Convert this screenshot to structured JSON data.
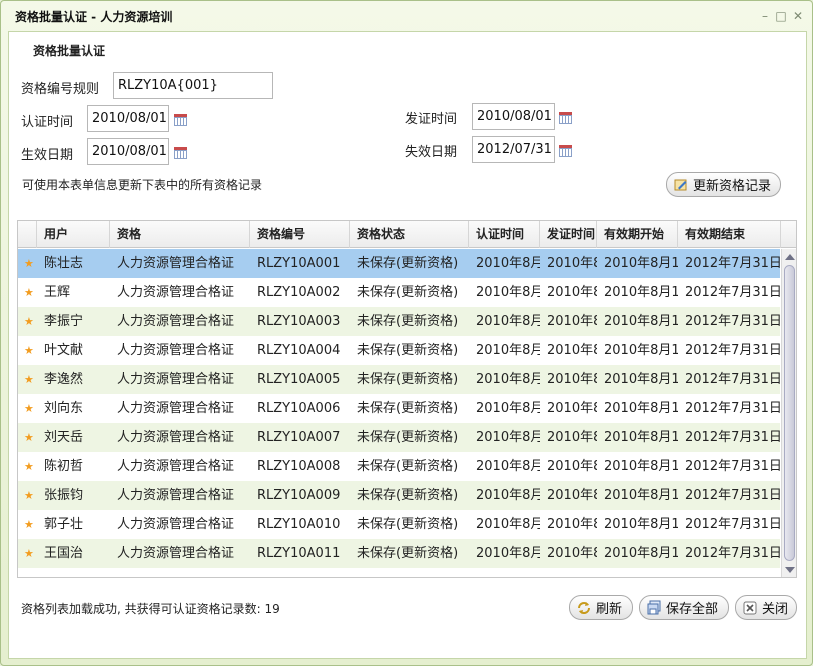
{
  "window": {
    "title": "资格批量认证 - 人力资源培训"
  },
  "form": {
    "section_title": "资格批量认证",
    "rule_label": "资格编号规则",
    "rule_value": "RLZY10A{001}",
    "cert_time_label": "认证时间",
    "cert_time_value": "2010/08/01",
    "issue_time_label": "发证时间",
    "issue_time_value": "2010/08/01",
    "effective_label": "生效日期",
    "effective_value": "2010/08/01",
    "expire_label": "失效日期",
    "expire_value": "2012/07/31",
    "hint": "可使用本表单信息更新下表中的所有资格记录",
    "update_button": "更新资格记录"
  },
  "grid": {
    "columns": [
      "用户",
      "资格",
      "资格编号",
      "资格状态",
      "认证时间",
      "发证时间",
      "有效期开始",
      "有效期结束"
    ],
    "rows": [
      {
        "user": "陈壮志",
        "qual": "人力资源管理合格证",
        "code": "RLZY10A001",
        "state": "未保存(更新资格)",
        "cert": "2010年8月",
        "issue": "2010年8",
        "start": "2010年8月1",
        "end": "2012年7月31日"
      },
      {
        "user": "王辉",
        "qual": "人力资源管理合格证",
        "code": "RLZY10A002",
        "state": "未保存(更新资格)",
        "cert": "2010年8月",
        "issue": "2010年8",
        "start": "2010年8月1",
        "end": "2012年7月31日"
      },
      {
        "user": "李振宁",
        "qual": "人力资源管理合格证",
        "code": "RLZY10A003",
        "state": "未保存(更新资格)",
        "cert": "2010年8月",
        "issue": "2010年8",
        "start": "2010年8月1",
        "end": "2012年7月31日"
      },
      {
        "user": "叶文献",
        "qual": "人力资源管理合格证",
        "code": "RLZY10A004",
        "state": "未保存(更新资格)",
        "cert": "2010年8月",
        "issue": "2010年8",
        "start": "2010年8月1",
        "end": "2012年7月31日"
      },
      {
        "user": "李逸然",
        "qual": "人力资源管理合格证",
        "code": "RLZY10A005",
        "state": "未保存(更新资格)",
        "cert": "2010年8月",
        "issue": "2010年8",
        "start": "2010年8月1",
        "end": "2012年7月31日"
      },
      {
        "user": "刘向东",
        "qual": "人力资源管理合格证",
        "code": "RLZY10A006",
        "state": "未保存(更新资格)",
        "cert": "2010年8月",
        "issue": "2010年8",
        "start": "2010年8月1",
        "end": "2012年7月31日"
      },
      {
        "user": "刘天岳",
        "qual": "人力资源管理合格证",
        "code": "RLZY10A007",
        "state": "未保存(更新资格)",
        "cert": "2010年8月",
        "issue": "2010年8",
        "start": "2010年8月1",
        "end": "2012年7月31日"
      },
      {
        "user": "陈初哲",
        "qual": "人力资源管理合格证",
        "code": "RLZY10A008",
        "state": "未保存(更新资格)",
        "cert": "2010年8月",
        "issue": "2010年8",
        "start": "2010年8月1",
        "end": "2012年7月31日"
      },
      {
        "user": "张振钧",
        "qual": "人力资源管理合格证",
        "code": "RLZY10A009",
        "state": "未保存(更新资格)",
        "cert": "2010年8月",
        "issue": "2010年8",
        "start": "2010年8月1",
        "end": "2012年7月31日"
      },
      {
        "user": "郭子壮",
        "qual": "人力资源管理合格证",
        "code": "RLZY10A010",
        "state": "未保存(更新资格)",
        "cert": "2010年8月",
        "issue": "2010年8",
        "start": "2010年8月1",
        "end": "2012年7月31日"
      },
      {
        "user": "王国治",
        "qual": "人力资源管理合格证",
        "code": "RLZY10A011",
        "state": "未保存(更新资格)",
        "cert": "2010年8月",
        "issue": "2010年8",
        "start": "2010年8月1",
        "end": "2012年7月31日"
      }
    ]
  },
  "status_text": "资格列表加载成功, 共获得可认证资格记录数: 19",
  "buttons": {
    "refresh": "刷新",
    "save_all": "保存全部",
    "close": "关闭"
  },
  "colors": {
    "selected_row": "#a6cdf0",
    "alt_row": "#eef5e3",
    "star": "#f29c1f"
  }
}
